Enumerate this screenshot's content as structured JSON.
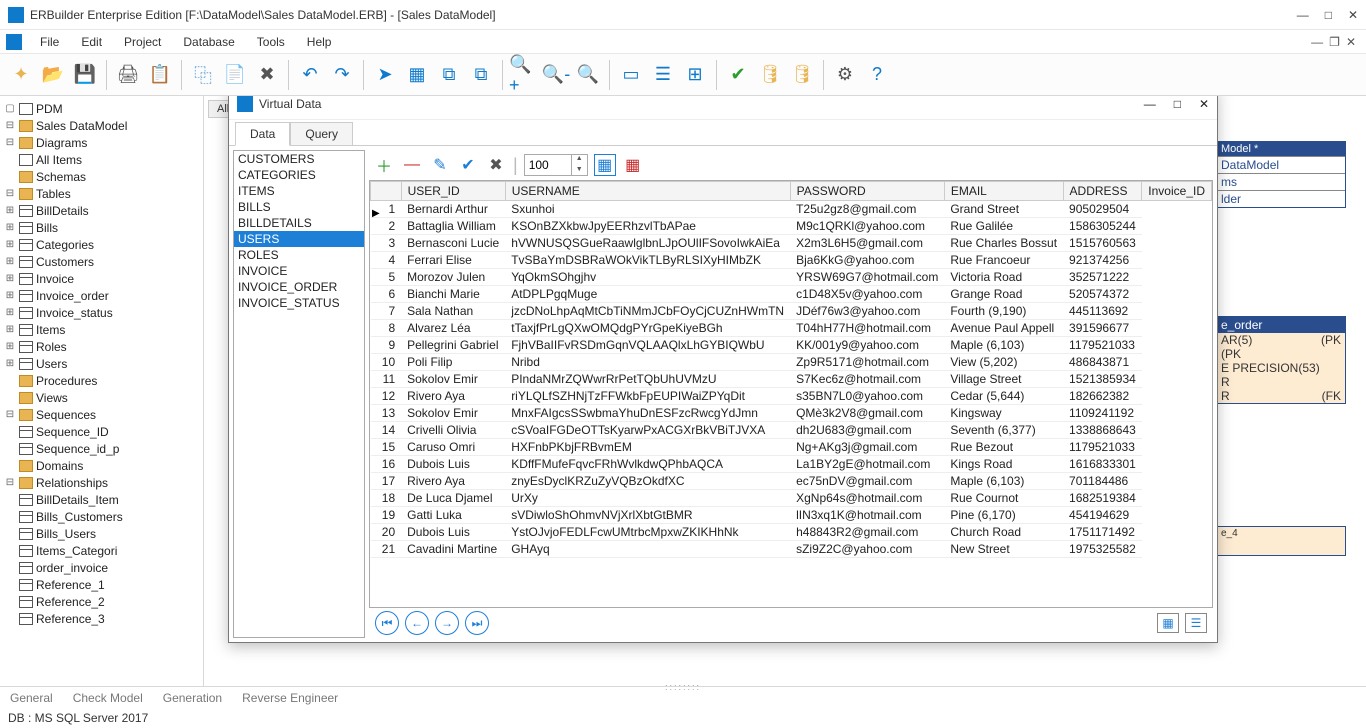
{
  "window": {
    "title": "ERBuilder Enterprise Edition [F:\\DataModel\\Sales DataModel.ERB] - [Sales DataModel]"
  },
  "menu": [
    "File",
    "Edit",
    "Project",
    "Database",
    "Tools",
    "Help"
  ],
  "tree": {
    "root": "PDM",
    "model": "Sales DataModel",
    "diagrams": "Diagrams",
    "diagrams_items": [
      "All Items"
    ],
    "schemas": "Schemas",
    "tables_lbl": "Tables",
    "tables": [
      "BillDetails",
      "Bills",
      "Categories",
      "Customers",
      "Invoice",
      "Invoice_order",
      "Invoice_status",
      "Items",
      "Roles",
      "Users"
    ],
    "procedures": "Procedures",
    "views": "Views",
    "sequences_lbl": "Sequences",
    "sequences": [
      "Sequence_ID",
      "Sequence_id_p"
    ],
    "domains": "Domains",
    "relationships_lbl": "Relationships",
    "relationships": [
      "BillDetails_Item",
      "Bills_Customers",
      "Bills_Users",
      "Items_Categori",
      "order_invoice",
      "Reference_1",
      "Reference_2",
      "Reference_3"
    ]
  },
  "canvas": {
    "tab": "All",
    "minimap": {
      "hdr": "Model *",
      "lines": [
        "DataModel",
        "ms",
        "lder"
      ]
    },
    "box2": {
      "hdr": "e_order",
      "rows": [
        [
          "AR(5)",
          "(PK"
        ],
        [
          "(PK",
          ""
        ],
        [
          "E PRECISION(53)",
          ""
        ],
        [
          "R",
          ""
        ],
        [
          "R",
          "(FK"
        ]
      ]
    },
    "box3": "e_4"
  },
  "dialog": {
    "title": "Virtual Data",
    "tabs": [
      "Data",
      "Query"
    ],
    "list": [
      "CUSTOMERS",
      "CATEGORIES",
      "ITEMS",
      "BILLS",
      "BILLDETAILS",
      "USERS",
      "ROLES",
      "INVOICE",
      "INVOICE_ORDER",
      "INVOICE_STATUS"
    ],
    "list_selected": "USERS",
    "limit": "100",
    "columns": [
      "USER_ID",
      "USERNAME",
      "PASSWORD",
      "EMAIL",
      "ADDRESS",
      "Invoice_ID"
    ],
    "rows": [
      [
        "1",
        "Bernardi Arthur",
        "Sxunhoi",
        "T25u2gz8@gmail.com",
        "Grand Street",
        "905029504"
      ],
      [
        "2",
        "Battaglia William",
        "KSOnBZXkbwJpyEERhzvlTbAPae",
        "M9c1QRKl@yahoo.com",
        "Rue Galilée",
        "1586305244"
      ],
      [
        "3",
        "Bernasconi Lucie",
        "hVWNUSQSGueRaawlglbnLJpOUlIFSovoIwkAiEa",
        "X2m3L6H5@gmail.com",
        "Rue Charles Bossut",
        "1515760563"
      ],
      [
        "4",
        "Ferrari Elise",
        "TvSBaYmDSBRaWOkVikTLByRLSIXyHIMbZK",
        "Bja6KkG@yahoo.com",
        "Rue Francoeur",
        "921374256"
      ],
      [
        "5",
        "Morozov Julen",
        "YqOkmSOhgjhv",
        "YRSW69G7@hotmail.com",
        "Victoria Road",
        "352571222"
      ],
      [
        "6",
        "Bianchi Marie",
        "AtDPLPgqMuge",
        "c1D48X5v@yahoo.com",
        "Grange Road",
        "520574372"
      ],
      [
        "7",
        "Sala Nathan",
        "jzcDNoLhpAqMtCbTiNMmJCbFOyCjCUZnHWmTN",
        "JDéf76w3@yahoo.com",
        "Fourth (9,190)",
        "445113692"
      ],
      [
        "8",
        "Alvarez Léa",
        "tTaxjfPrLgQXwOMQdgPYrGpeKiyeBGh",
        "T04hH77H@hotmail.com",
        "Avenue Paul Appell",
        "391596677"
      ],
      [
        "9",
        "Pellegrini Gabriel",
        "FjhVBaIIFvRSDmGqnVQLAAQlxLhGYBIQWbU",
        "KK/001y9@yahoo.com",
        "Maple (6,103)",
        "1179521033"
      ],
      [
        "10",
        "Poli Filip",
        "Nribd",
        "Zp9R5171@hotmail.com",
        "View (5,202)",
        "486843871"
      ],
      [
        "11",
        "Sokolov Emir",
        "PIndaNMrZQWwrRrPetTQbUhUVMzU",
        "S7Kec6z@hotmail.com",
        "Village Street",
        "1521385934"
      ],
      [
        "12",
        "Rivero Aya",
        "riYLQLfSZHNjTzFFWkbFpEUPIWaiZPYqDit",
        "s35BN7L0@yahoo.com",
        "Cedar (5,644)",
        "182662382"
      ],
      [
        "13",
        "Sokolov Emir",
        "MnxFAIgcsSSwbmaYhuDnESFzcRwcgYdJmn",
        "QMè3k2V8@gmail.com",
        "Kingsway",
        "1109241192"
      ],
      [
        "14",
        "Crivelli Olivia",
        "cSVoaIFGDeOTTsKyarwPxACGXrBkVBiTJVXA",
        "dh2U683@gmail.com",
        "Seventh (6,377)",
        "1338868643"
      ],
      [
        "15",
        "Caruso Omri",
        "HXFnbPKbjFRBvmEM",
        "Ng+AKg3j@gmail.com",
        "Rue Bezout",
        "1179521033"
      ],
      [
        "16",
        "Dubois Luis",
        "KDffFMufeFqvcFRhWvlkdwQPhbAQCA",
        "La1BY2gE@hotmail.com",
        "Kings Road",
        "1616833301"
      ],
      [
        "17",
        "Rivero Aya",
        "znyEsDyclKRZuZyVQBzOkdfXC",
        "ec75nDV@gmail.com",
        "Maple (6,103)",
        "701184486"
      ],
      [
        "18",
        "De Luca Djamel",
        "UrXy",
        "XgNp64s@hotmail.com",
        "Rue Cournot",
        "1682519384"
      ],
      [
        "19",
        "Gatti Luka",
        "sVDiwloShOhmvNVjXrlXbtGtBMR",
        "lIN3xq1K@hotmail.com",
        "Pine (6,170)",
        "454194629"
      ],
      [
        "20",
        "Dubois Luis",
        "YstOJvjoFEDLFcwUMtrbcMpxwZKIKHhNk",
        "h48843R2@gmail.com",
        "Church Road",
        "1751171492"
      ],
      [
        "21",
        "Cavadini Martine",
        "GHAyq",
        "sZi9Z2C@yahoo.com",
        "New Street",
        "1975325582"
      ]
    ]
  },
  "status": {
    "tabs": [
      "General",
      "Check Model",
      "Generation",
      "Reverse Engineer"
    ],
    "db": "DB : MS SQL Server 2017"
  }
}
